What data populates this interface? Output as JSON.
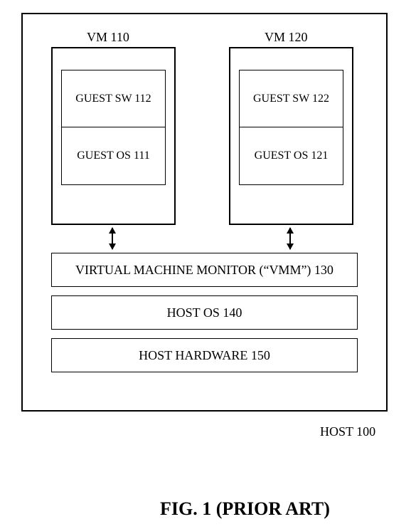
{
  "vm1": {
    "label": "VM 110",
    "guest_sw": "GUEST SW 112",
    "guest_os": "GUEST OS 111"
  },
  "vm2": {
    "label": "VM 120",
    "guest_sw": "GUEST SW 122",
    "guest_os": "GUEST OS 121"
  },
  "stack": {
    "vmm": "VIRTUAL MACHINE MONITOR (“VMM”) 130",
    "host_os": "HOST OS 140",
    "host_hw": "HOST HARDWARE 150"
  },
  "host_label": "HOST 100",
  "figure_label": "FIG. 1 (PRIOR ART)"
}
